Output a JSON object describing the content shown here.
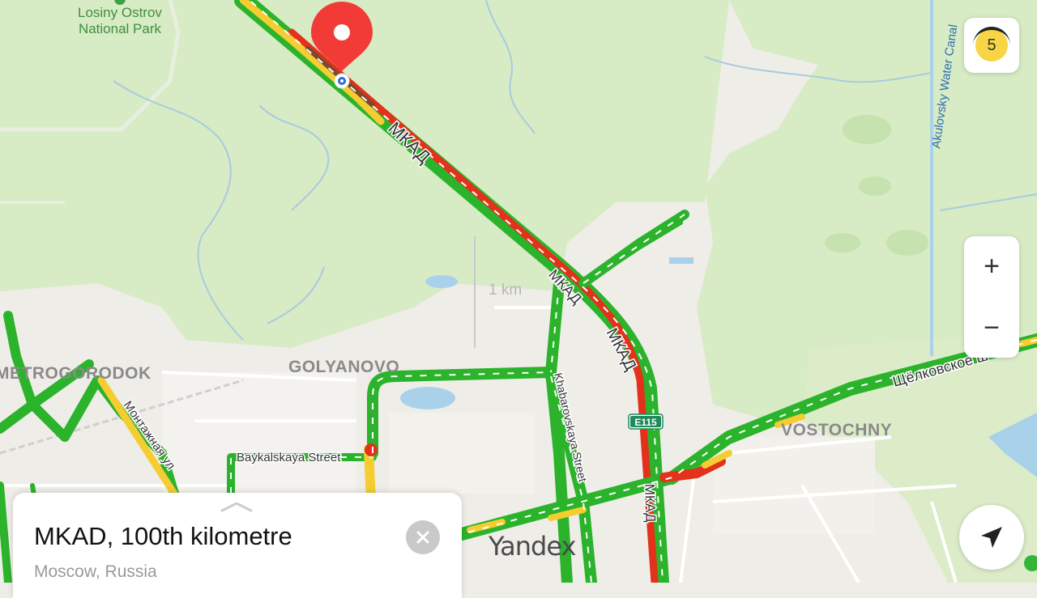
{
  "map": {
    "park_label_line1": "Losiny Ostrov",
    "park_label_line2": "National Park",
    "districts": {
      "metrogorodok": "METROGORODOK",
      "golyanovo": "GOLYANOVO",
      "vostochny": "VOSTOCHNY"
    },
    "roads": {
      "mkad_1": "МКАД",
      "mkad_2": "МКАД",
      "mkad_3": "МКАД",
      "mkad_4": "МКАД",
      "schelkovskoe": "Щёлковское ш",
      "montazhnaya": "Монтажная ул",
      "baykalskaya": "Baykalskaya Street",
      "khabarovskaya": "Khabarovskaya Street",
      "akulovsky": "Akulovsky Water Canal",
      "route_badge": "E115"
    },
    "scale_text": "1 km",
    "logo": "Yandex",
    "colors": {
      "forest": "#d7ebc4",
      "urban": "#efede8",
      "water": "#a9d1ea",
      "traffic_free": "#2bb32b",
      "traffic_slow": "#f5cd33",
      "traffic_jam": "#e3311c",
      "marker": "#f23a36"
    }
  },
  "controls": {
    "traffic_level": "5",
    "zoom_in": "+",
    "zoom_out": "−",
    "locate_icon": "location-arrow-icon"
  },
  "place_card": {
    "title": "MKAD, 100th kilometre",
    "subtitle": "Moscow, Russia",
    "close_icon": "close-icon"
  }
}
